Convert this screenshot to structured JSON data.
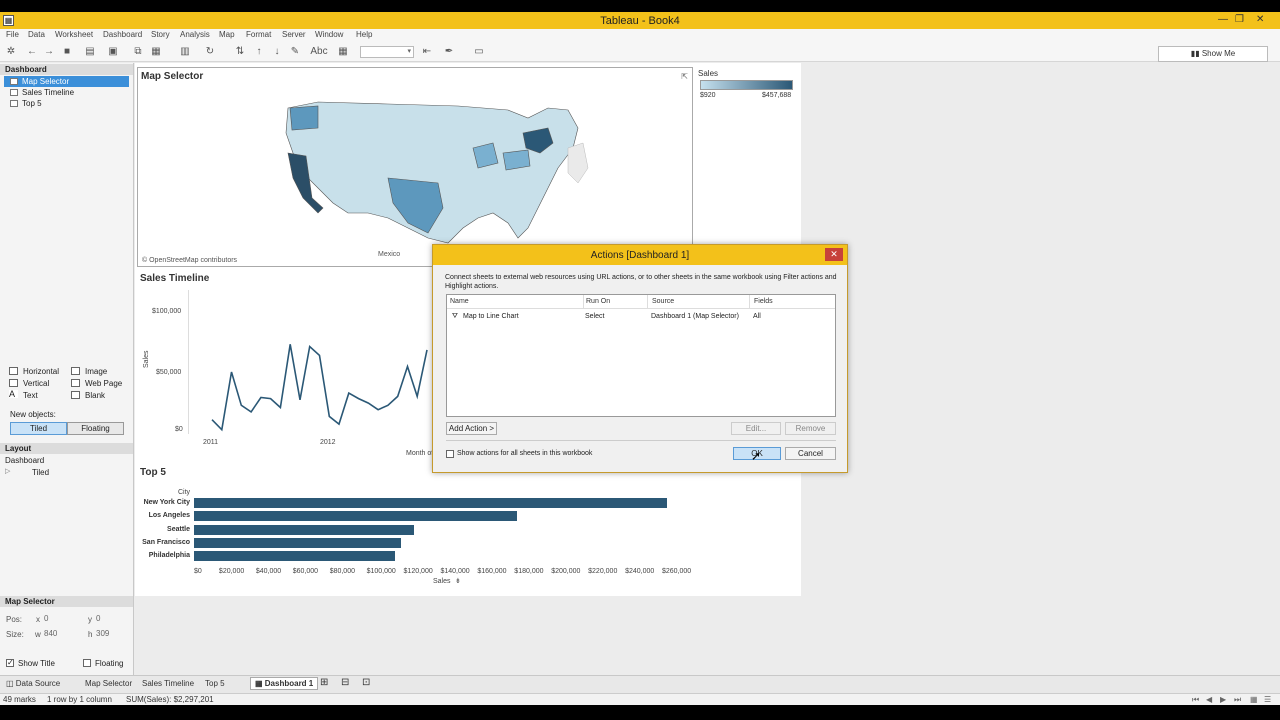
{
  "window": {
    "title": "Tableau - Book4",
    "app_icon_glyph": "▦",
    "min": "—",
    "restore": "❐",
    "close": "✕"
  },
  "menu": [
    "File",
    "Data",
    "Worksheet",
    "Dashboard",
    "Story",
    "Analysis",
    "Map",
    "Format",
    "Server",
    "Window",
    "Help"
  ],
  "toolbar": {
    "show_me": "Show Me",
    "abc_label": "Abc"
  },
  "dashboard_panel": {
    "header": "Dashboard",
    "sheets": [
      "Map Selector",
      "Sales Timeline",
      "Top 5"
    ],
    "objects": {
      "horizontal": "Horizontal",
      "vertical": "Vertical",
      "text": "Text",
      "image": "Image",
      "web_page": "Web Page",
      "blank": "Blank"
    },
    "new_objects_label": "New objects:",
    "tiled": "Tiled",
    "floating": "Floating"
  },
  "layout_panel": {
    "header": "Layout",
    "root": "Dashboard",
    "child": "Tiled"
  },
  "selection_panel": {
    "header": "Map Selector",
    "pos_label": "Pos:",
    "x_label": "x",
    "x_value": "0",
    "y_label": "y",
    "y_value": "0",
    "size_label": "Size:",
    "w_label": "w",
    "w_value": "840",
    "h_label": "h",
    "h_value": "309",
    "show_title": "Show Title",
    "floating": "Floating"
  },
  "map_zone": {
    "title": "Map Selector",
    "credit": "© OpenStreetMap contributors",
    "mexico_label": "Mexico"
  },
  "legend": {
    "title": "Sales",
    "min": "$920",
    "max": "$457,688"
  },
  "timeline": {
    "title": "Sales Timeline",
    "ylabel": "Sales",
    "xlabel": "Month of",
    "yticks": [
      "$100,000",
      "$50,000",
      "$0"
    ],
    "xticks": [
      "2011",
      "2012"
    ]
  },
  "top5": {
    "title": "Top 5",
    "row_header": "City",
    "xlabel": "Sales",
    "sort_icon": "sort-icon"
  },
  "chart_data": [
    {
      "type": "line",
      "title": "Sales Timeline",
      "ylabel": "Sales",
      "xlabel": "Month of",
      "ylim": [
        0,
        120000
      ],
      "x_ticks": [
        "2011",
        "2012"
      ],
      "values": [
        12000,
        3000,
        55000,
        25000,
        19000,
        32000,
        31000,
        23000,
        80000,
        30000,
        78000,
        70000,
        15000,
        8000,
        36000,
        31000,
        27000,
        21000,
        25000,
        33000,
        60000,
        33000,
        75000
      ]
    },
    {
      "type": "bar",
      "title": "Top 5",
      "orientation": "horizontal",
      "categories": [
        "New York City",
        "Los Angeles",
        "Seattle",
        "San Francisco",
        "Philadelphia"
      ],
      "values": [
        256000,
        175000,
        119000,
        112000,
        109000
      ],
      "xlabel": "Sales",
      "ylabel": "City",
      "xlim": [
        0,
        270000
      ],
      "x_ticks": [
        "$0",
        "$20,000",
        "$40,000",
        "$60,000",
        "$80,000",
        "$100,000",
        "$120,000",
        "$140,000",
        "$160,000",
        "$180,000",
        "$200,000",
        "$220,000",
        "$240,000",
        "$260,000"
      ],
      "bar_color": "#2b5876"
    }
  ],
  "dialog": {
    "title": "Actions [Dashboard 1]",
    "close": "✕",
    "description": "Connect sheets to external web resources using URL actions, or to other sheets in the same workbook using Filter actions and Highlight actions.",
    "columns": [
      "Name",
      "Run On",
      "Source",
      "Fields"
    ],
    "rows": [
      {
        "name": "Map to Line Chart",
        "run_on": "Select",
        "source": "Dashboard 1 (Map Selector)",
        "fields": "All"
      }
    ],
    "add_action": "Add Action >",
    "edit": "Edit...",
    "remove": "Remove",
    "show_all": "Show actions for all sheets in this workbook",
    "ok": "OK",
    "cancel": "Cancel"
  },
  "tabs": {
    "data_source": "Data Source",
    "sheets": [
      "Map Selector",
      "Sales Timeline",
      "Top 5"
    ],
    "active": "Dashboard 1"
  },
  "status": {
    "marks": "49 marks",
    "rows": "1 row by 1 column",
    "sum": "SUM(Sales): $2,297,201"
  },
  "colors": {
    "accent": "#f3c11a",
    "bar": "#2b5876",
    "selection": "#3b8fd9"
  }
}
